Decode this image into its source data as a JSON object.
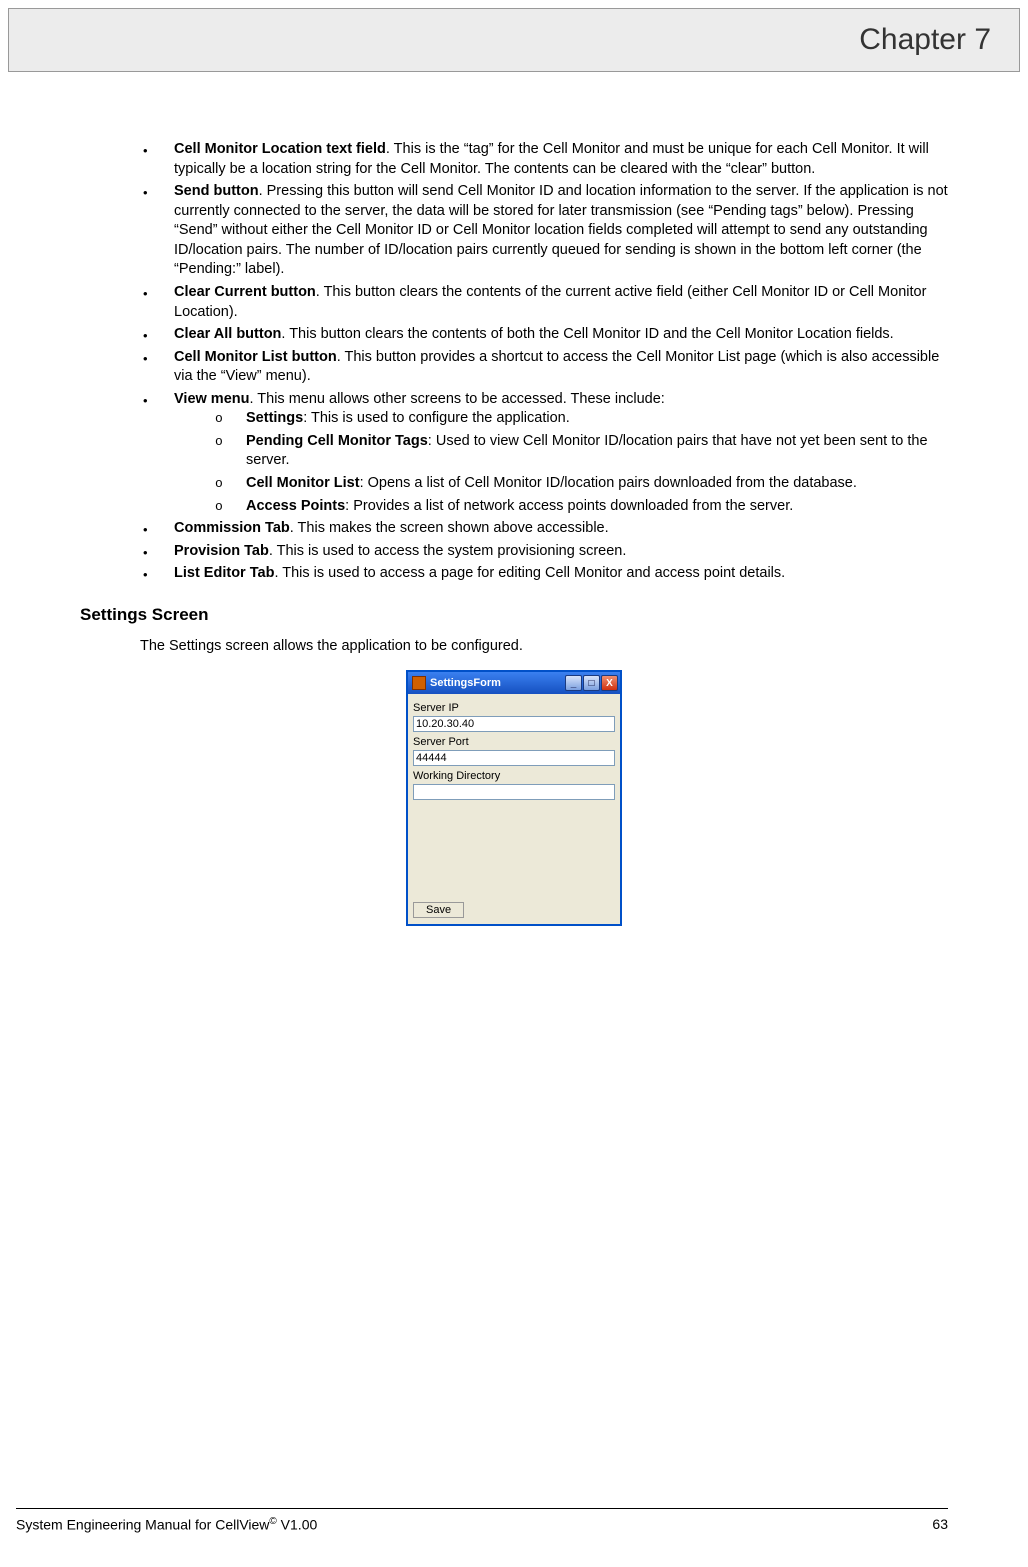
{
  "header": {
    "chapter": "Chapter 7"
  },
  "bullets": [
    {
      "label": "Cell Monitor Location text field",
      "text": ".  This is the “tag” for the Cell Monitor and must be unique for each Cell Monitor.  It will typically be a location string for the Cell Monitor.  The contents can be cleared with the “clear” button."
    },
    {
      "label": "Send button",
      "text": ".  Pressing this button will send Cell Monitor ID and location information to the server.  If the application is not currently connected to the server, the data will be stored for later transmission (see “Pending tags” below).  Pressing “Send” without either the Cell Monitor ID or Cell Monitor location fields completed will attempt to send any outstanding ID/location pairs.  The number of ID/location pairs currently queued for sending is shown in the bottom left corner (the “Pending:” label)."
    },
    {
      "label": "Clear Current button",
      "text": ".  This button clears the contents of the current active field (either Cell Monitor ID or Cell Monitor Location)."
    },
    {
      "label": "Clear All button",
      "text": ".  This button clears the contents of both the Cell Monitor ID and the Cell Monitor Location fields."
    },
    {
      "label": "Cell Monitor List button",
      "text": ".  This button provides a shortcut to access the Cell Monitor List page (which is also accessible via the “View” menu)."
    },
    {
      "label": "View menu",
      "text": ".  This menu allows other screens to be accessed.  These include:"
    },
    {
      "label": "Commission Tab",
      "text": ".  This makes the screen shown above accessible."
    },
    {
      "label": "Provision Tab",
      "text": ".  This is used to access the system provisioning screen."
    },
    {
      "label": "List Editor Tab",
      "text": ".  This is used to access a page for editing Cell Monitor and access point details."
    }
  ],
  "subbullets": [
    {
      "label": "Settings",
      "text": ":  This is used to configure the application."
    },
    {
      "label": "Pending Cell Monitor Tags",
      "text": ": Used to view Cell Monitor ID/location pairs that have not yet been sent to the server."
    },
    {
      "label": "Cell Monitor List",
      "text": ": Opens a list of Cell Monitor ID/location pairs downloaded from the database."
    },
    {
      "label": "Access Points",
      "text": ": Provides a list of network access points downloaded from the server."
    }
  ],
  "section": {
    "title": "Settings Screen",
    "intro": "The Settings screen allows the application to be configured."
  },
  "settings_form": {
    "window_title": "SettingsForm",
    "server_ip_label": "Server IP",
    "server_ip_value": "10.20.30.40",
    "server_port_label": "Server Port",
    "server_port_value": "44444",
    "working_dir_label": "Working Directory",
    "working_dir_value": "",
    "save_label": "Save",
    "min_glyph": "_",
    "max_glyph": "□",
    "close_glyph": "X"
  },
  "footer": {
    "left_pre": "System Engineering Manual for CellView",
    "left_post": " V1.00",
    "page": "63"
  }
}
